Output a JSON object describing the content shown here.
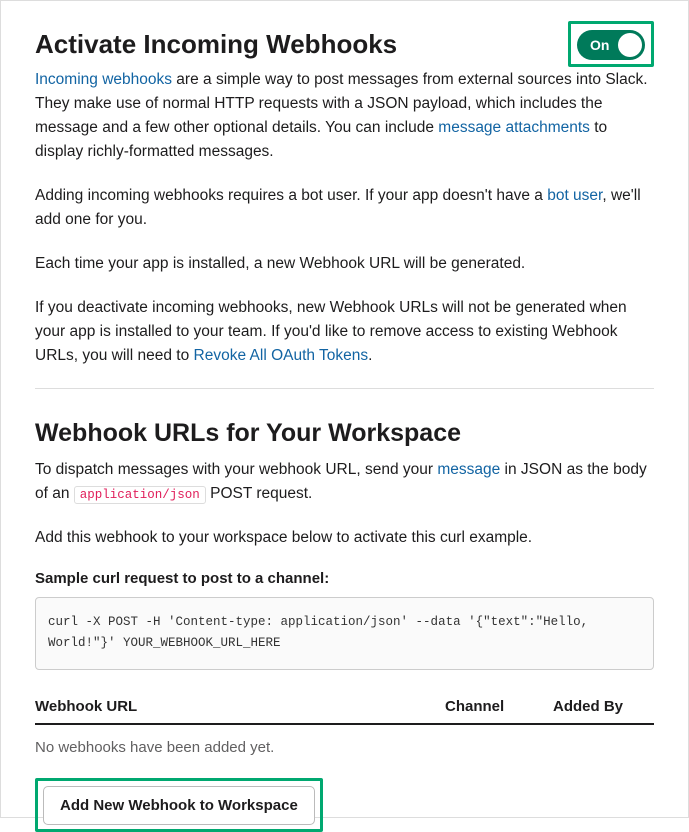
{
  "section1": {
    "title": "Activate Incoming Webhooks",
    "toggle": {
      "label": "On",
      "state": true
    },
    "p1a": "Incoming webhooks",
    "p1b": " are a simple way to post messages from external sources into Slack. They make use of normal HTTP requests with a JSON payload, which includes the message and a few other optional details. You can include ",
    "p1c": "message attachments",
    "p1d": " to display richly-formatted messages.",
    "p2a": "Adding incoming webhooks requires a bot user. If your app doesn't have a ",
    "p2b": "bot user",
    "p2c": ", we'll add one for you.",
    "p3": "Each time your app is installed, a new Webhook URL will be generated.",
    "p4a": "If you deactivate incoming webhooks, new Webhook URLs will not be generated when your app is installed to your team. If you'd like to remove access to existing Webhook URLs, you will need to ",
    "p4b": "Revoke All OAuth Tokens",
    "p4c": "."
  },
  "section2": {
    "title": "Webhook URLs for Your Workspace",
    "p1a": "To dispatch messages with your webhook URL, send your ",
    "p1b": "message",
    "p1c": " in JSON as the body of an ",
    "p1d": "application/json",
    "p1e": " POST request.",
    "p2": "Add this webhook to your workspace below to activate this curl example.",
    "sample_label": "Sample curl request to post to a channel:",
    "code": "curl -X POST -H 'Content-type: application/json' --data '{\"text\":\"Hello, World!\"}' YOUR_WEBHOOK_URL_HERE",
    "col_url": "Webhook URL",
    "col_channel": "Channel",
    "col_added": "Added By",
    "empty": "No webhooks have been added yet.",
    "button": "Add New Webhook to Workspace"
  }
}
